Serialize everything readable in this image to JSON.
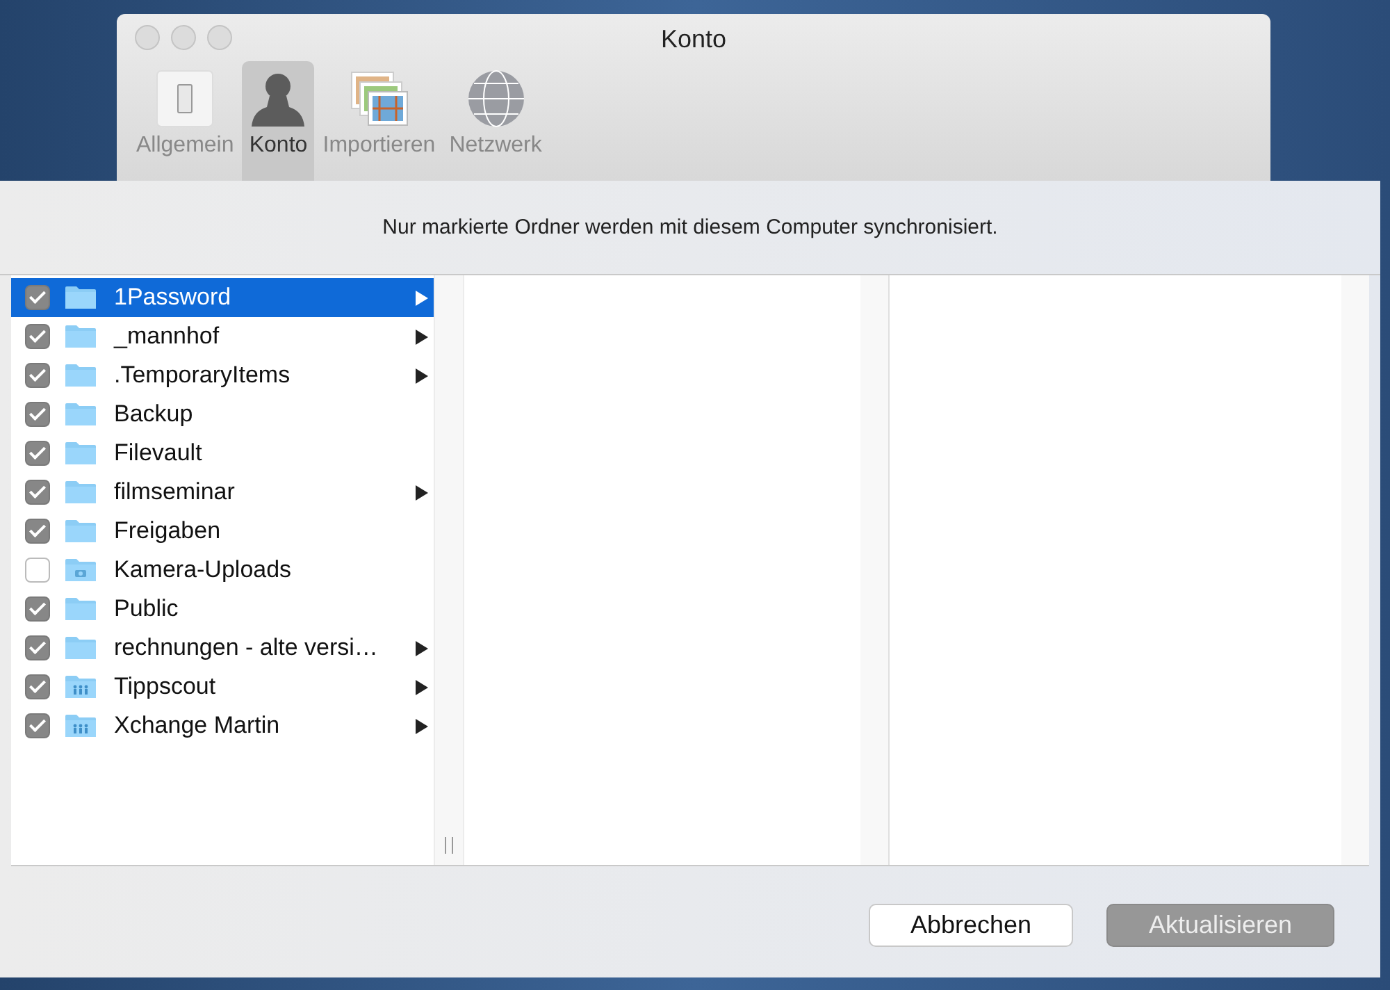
{
  "window": {
    "title": "Konto"
  },
  "toolbar": [
    {
      "label": "Allgemein",
      "kind": "switch",
      "selected": false
    },
    {
      "label": "Konto",
      "kind": "person",
      "selected": true
    },
    {
      "label": "Importieren",
      "kind": "photos",
      "selected": false
    },
    {
      "label": "Netzwerk",
      "kind": "globe",
      "selected": false
    }
  ],
  "sheet": {
    "message": "Nur markierte Ordner werden mit diesem Computer synchronisiert.",
    "folders": [
      {
        "name": "1Password",
        "kind": "folder",
        "checked": true,
        "has_children": true,
        "selected": true
      },
      {
        "name": "_mannhof",
        "kind": "folder",
        "checked": true,
        "has_children": true,
        "selected": false
      },
      {
        "name": ".TemporaryItems",
        "kind": "folder",
        "checked": true,
        "has_children": true,
        "selected": false
      },
      {
        "name": "Backup",
        "kind": "folder",
        "checked": true,
        "has_children": false,
        "selected": false
      },
      {
        "name": "Filevault",
        "kind": "folder",
        "checked": true,
        "has_children": false,
        "selected": false
      },
      {
        "name": "filmseminar",
        "kind": "folder",
        "checked": true,
        "has_children": true,
        "selected": false
      },
      {
        "name": "Freigaben",
        "kind": "folder",
        "checked": true,
        "has_children": false,
        "selected": false
      },
      {
        "name": "Kamera-Uploads",
        "kind": "camera",
        "checked": false,
        "has_children": false,
        "selected": false
      },
      {
        "name": "Public",
        "kind": "folder",
        "checked": true,
        "has_children": false,
        "selected": false
      },
      {
        "name": "rechnungen - alte versi…",
        "kind": "folder",
        "checked": true,
        "has_children": true,
        "selected": false
      },
      {
        "name": "Tippscout",
        "kind": "shared",
        "checked": true,
        "has_children": true,
        "selected": false
      },
      {
        "name": "Xchange Martin",
        "kind": "shared",
        "checked": true,
        "has_children": true,
        "selected": false
      }
    ],
    "buttons": [
      {
        "label": "Abbrechen",
        "disabled": false
      },
      {
        "label": "Aktualisieren",
        "disabled": true
      }
    ]
  }
}
